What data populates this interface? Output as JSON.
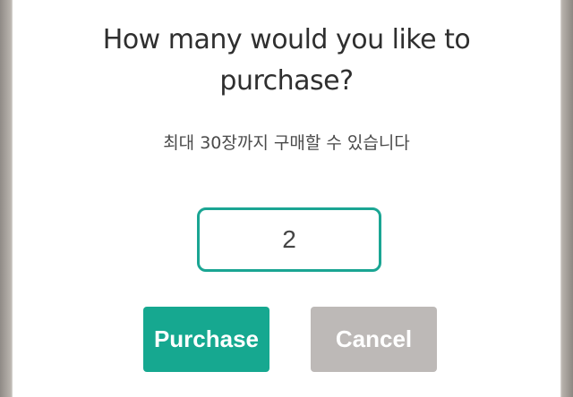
{
  "dialog": {
    "title_line1": "How many would you like to",
    "title_line2": "purchase?",
    "subtitle": "최대 30장까지 구매할 수 있습니다",
    "quantity": {
      "value": "2"
    },
    "purchase_label": "Purchase",
    "cancel_label": "Cancel"
  },
  "colors": {
    "accent": "#16a890",
    "input_border": "#1aa593",
    "cancel_bg": "#bdb9b7",
    "title_text": "#2f2f2f"
  }
}
